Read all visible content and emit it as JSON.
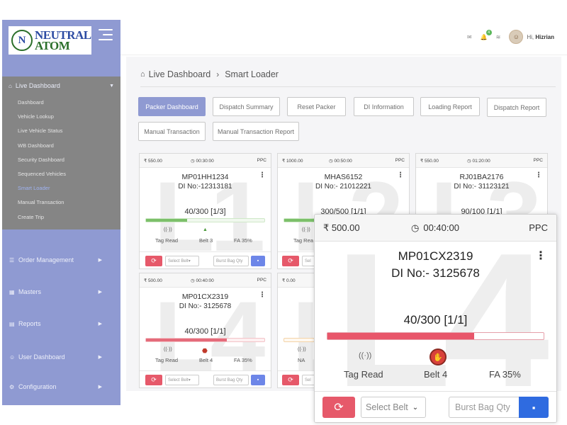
{
  "brand": {
    "logo_line1": "NEUTRAL",
    "logo_line2": "ATOM",
    "logo_mark": "N"
  },
  "topbar": {
    "greeting_prefix": "Hi,",
    "user_name": "Hizrian",
    "notification_count": "4"
  },
  "sidebar": {
    "live_dashboard": {
      "label": "Live Dashboard",
      "items": [
        "Dashboard",
        "Vehicle Lookup",
        "Live Vehicle Status",
        "WB Dashboard",
        "Security Dashboard",
        "Sequenced Vehicles",
        "Smart Loader",
        "Manual Transaction",
        "Create Trip"
      ],
      "active_item": "Smart Loader"
    },
    "menus": [
      "Order Management",
      "Masters",
      "Reports",
      "User Dashboard",
      "Configuration"
    ]
  },
  "breadcrumb": {
    "root": "Live Dashboard",
    "current": "Smart Loader"
  },
  "tabs": [
    "Packer Dashboard",
    "Dispatch Summary",
    "Reset Packer",
    "DI Information",
    "Loading Report",
    "Dispatch Report",
    "Manual Transaction",
    "Manual Transaction Report"
  ],
  "cards": [
    {
      "amount": "₹ 550.00",
      "time": "00:30:00",
      "type": "PPC",
      "bg_letter": "L1",
      "vehicle": "MP01HH1234",
      "di": "DI No:-12313181",
      "count": "40/300 [1/3]",
      "progress": 0.35,
      "color": "green",
      "tag": "Tag Read",
      "belt": "Belt 3",
      "fa": "FA 35%"
    },
    {
      "amount": "₹ 1000.00",
      "time": "00:50:00",
      "type": "PPC",
      "bg_letter": "L2",
      "vehicle": "MHAS6152",
      "di": "DI No:- 21012221",
      "count": "300/500 [1/1]",
      "progress": 0.6,
      "color": "green",
      "tag": "Tag Rea",
      "belt": "",
      "fa": ""
    },
    {
      "amount": "₹ 550.00",
      "time": "01:20:00",
      "type": "PPC",
      "bg_letter": "L3",
      "vehicle": "RJ01BA2176",
      "di": "DI No:- 31123121",
      "count": "90/100 [1/1]",
      "progress": 0.9,
      "color": "green",
      "tag": "",
      "belt": "",
      "fa": ""
    },
    {
      "amount": "₹ 500.00",
      "time": "00:40:00",
      "type": "PPC",
      "bg_letter": "L4",
      "vehicle": "MP01CX2319",
      "di": "DI No:- 3125678",
      "count": "40/300 [1/1]",
      "progress": 0.68,
      "color": "red",
      "tag": "Tag Read",
      "belt": "Belt 4",
      "fa": "FA 35%"
    },
    {
      "amount": "₹ 0.00",
      "time": "",
      "type": "",
      "bg_letter": "L5",
      "vehicle": "",
      "di": "",
      "count": "",
      "progress": 0.0,
      "color": "orange",
      "tag": "NA",
      "belt": "",
      "fa": ""
    }
  ],
  "card_footer": {
    "select_placeholder": "Select Belt",
    "qty_placeholder": "Burst Bag Qty",
    "sel_short": "Sel"
  },
  "zoom_card": {
    "amount": "₹ 500.00",
    "time": "00:40:00",
    "type": "PPC",
    "bg_letter": "L4",
    "vehicle": "MP01CX2319",
    "di": "DI No:- 3125678",
    "count": "40/300 [1/1]",
    "progress": 0.68,
    "tag": "Tag Read",
    "belt": "Belt 4",
    "fa": "FA 35%",
    "select_placeholder": "Select Belt",
    "qty_placeholder": "Burst Bag Qty"
  },
  "colors": {
    "accent": "#8f9ad2",
    "danger": "#e6596a",
    "primary": "#2f6be0",
    "success": "#7cc06a"
  }
}
